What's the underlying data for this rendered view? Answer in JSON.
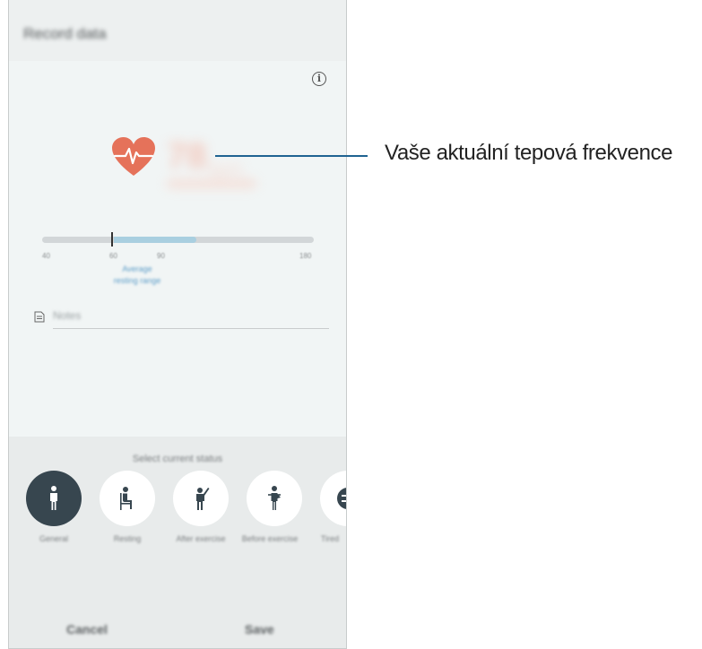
{
  "app": {
    "title": "Record data"
  },
  "measurement": {
    "value": "78",
    "unit": "bpm"
  },
  "range": {
    "ticks": [
      "40",
      "60",
      "90",
      "180"
    ],
    "label_line1": "Average",
    "label_line2": "resting range"
  },
  "notes": {
    "placeholder": "Notes"
  },
  "status": {
    "heading": "Select current status",
    "items": [
      {
        "label": "General",
        "icon": "standing-person-icon",
        "selected": true
      },
      {
        "label": "Resting",
        "icon": "sitting-person-icon",
        "selected": false
      },
      {
        "label": "After exercise",
        "icon": "exercise-person-icon",
        "selected": false
      },
      {
        "label": "Before exercise",
        "icon": "stretching-person-icon",
        "selected": false
      },
      {
        "label": "Tired",
        "icon": "face-icon",
        "selected": false
      }
    ]
  },
  "actions": {
    "cancel": "Cancel",
    "save": "Save"
  },
  "callout": {
    "text": "Vaše aktuální tepová frekvence"
  },
  "colors": {
    "accent": "#1f6391",
    "heart": "#e5725a",
    "selected_status": "#37464f",
    "range_fill": "#a9cfe0"
  }
}
